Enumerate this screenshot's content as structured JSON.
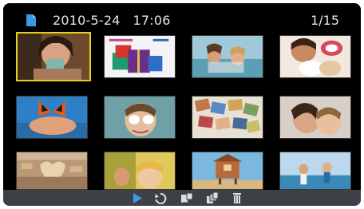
{
  "header": {
    "date": "2010-5-24",
    "time": "17:06",
    "counter": "1/15"
  },
  "icons": {
    "file": "file-icon",
    "play": "play-icon",
    "rotate": "rotate-icon",
    "copy": "copy-icon",
    "slideshow": "multi-photo-icon",
    "delete": "trash-icon"
  },
  "colors": {
    "screen": "#000000",
    "selection": "#e6d21a",
    "toolbar": "#3d4147",
    "accent": "#3a9bdc"
  },
  "thumbnails": [
    {
      "id": "photo-1",
      "selected": true
    },
    {
      "id": "photo-2",
      "selected": false
    },
    {
      "id": "photo-3",
      "selected": false
    },
    {
      "id": "photo-4",
      "selected": false
    },
    {
      "id": "photo-5",
      "selected": false
    },
    {
      "id": "photo-6",
      "selected": false
    },
    {
      "id": "photo-7",
      "selected": false
    },
    {
      "id": "photo-8",
      "selected": false
    },
    {
      "id": "photo-9",
      "selected": false
    },
    {
      "id": "photo-10",
      "selected": false
    },
    {
      "id": "photo-11",
      "selected": false
    },
    {
      "id": "photo-12",
      "selected": false
    }
  ]
}
